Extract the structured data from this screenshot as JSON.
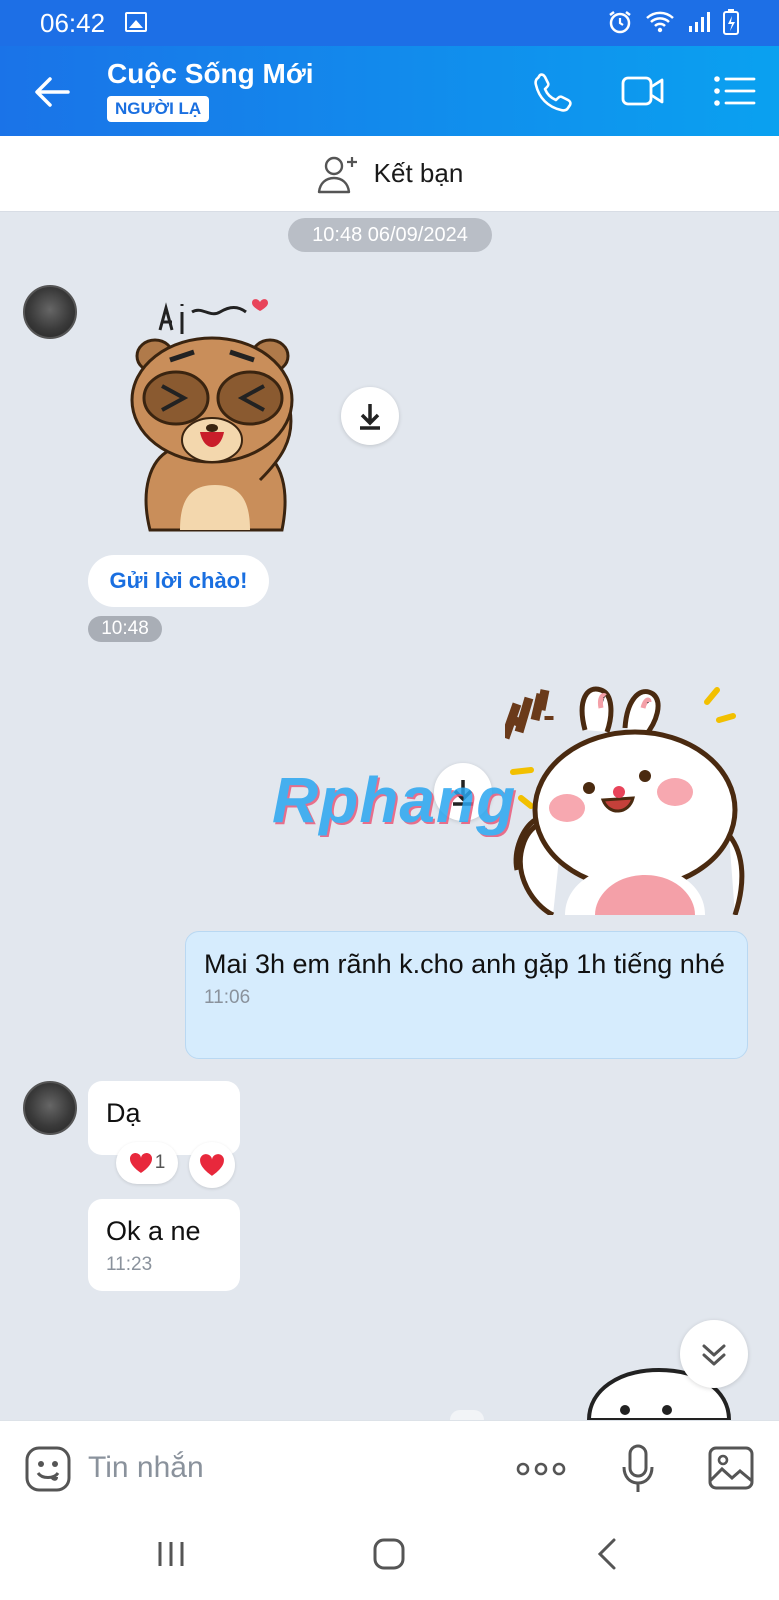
{
  "status_bar": {
    "time": "06:42"
  },
  "header": {
    "title": "Cuộc Sống Mới",
    "badge": "NGƯỜI LẠ"
  },
  "add_friend": {
    "label": "Kết bạn"
  },
  "chat": {
    "date_separator": "10:48 06/09/2024",
    "greeting_button": "Gửi lời chào!",
    "greeting_time": "10:48",
    "watermark": "Rphang",
    "messages": [
      {
        "sender": "me",
        "text": "Mai 3h em rãnh k.cho anh gặp 1h tiếng nhé",
        "time": "11:06"
      },
      {
        "sender": "them",
        "text": "Dạ",
        "reaction_count": "1"
      },
      {
        "sender": "them",
        "text": "Ok a ne",
        "time": "11:23"
      }
    ]
  },
  "input": {
    "placeholder": "Tin nhắn"
  },
  "colors": {
    "header_start": "#1a73e8",
    "header_end": "#0aa1f0",
    "outgoing_bubble": "#d6ecfd",
    "accent": "#1a6fe0"
  }
}
